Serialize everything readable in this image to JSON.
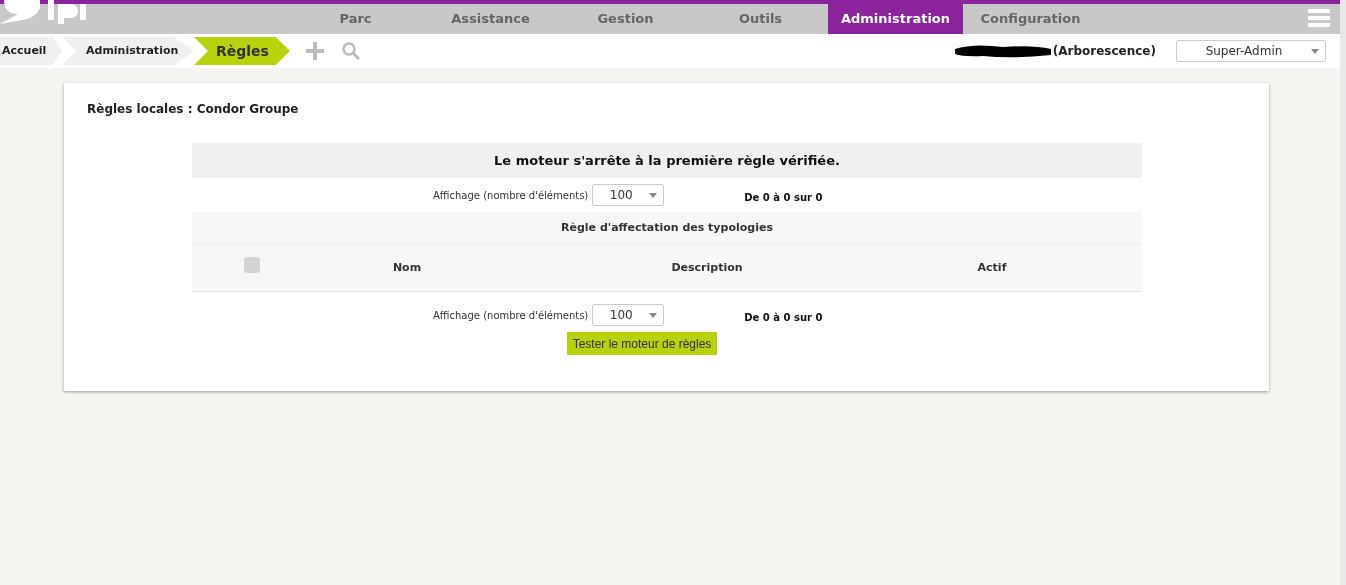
{
  "nav": {
    "tabs": [
      {
        "label": "Parc",
        "selected": false
      },
      {
        "label": "Assistance",
        "selected": false
      },
      {
        "label": "Gestion",
        "selected": false
      },
      {
        "label": "Outils",
        "selected": false
      },
      {
        "label": "Administration",
        "selected": true
      },
      {
        "label": "Configuration",
        "selected": false
      }
    ]
  },
  "breadcrumb": [
    {
      "label": "Accueil",
      "selected": false
    },
    {
      "label": "Administration",
      "selected": false
    },
    {
      "label": "Règles",
      "selected": true
    }
  ],
  "entity": {
    "label": "(Arborescence)"
  },
  "profile": {
    "value": "Super-Admin"
  },
  "panel": {
    "title": "Règles locales : Condor Groupe",
    "notice": "Le moteur s'arrête à la première règle vérifiée.",
    "pager_top": {
      "label": "Affichage (nombre d'éléments)",
      "value": "100",
      "count": "De 0 à 0 sur 0"
    },
    "table": {
      "caption": "Règle d'affectation des typologies",
      "select_all": {
        "checked": false
      },
      "columns": [
        "Nom",
        "Description",
        "Actif"
      ]
    },
    "pager_bottom": {
      "label": "Affichage (nombre d'éléments)",
      "value": "100",
      "count": "De 0 à 0 sur 0"
    },
    "button": "Tester le moteur de règles"
  }
}
